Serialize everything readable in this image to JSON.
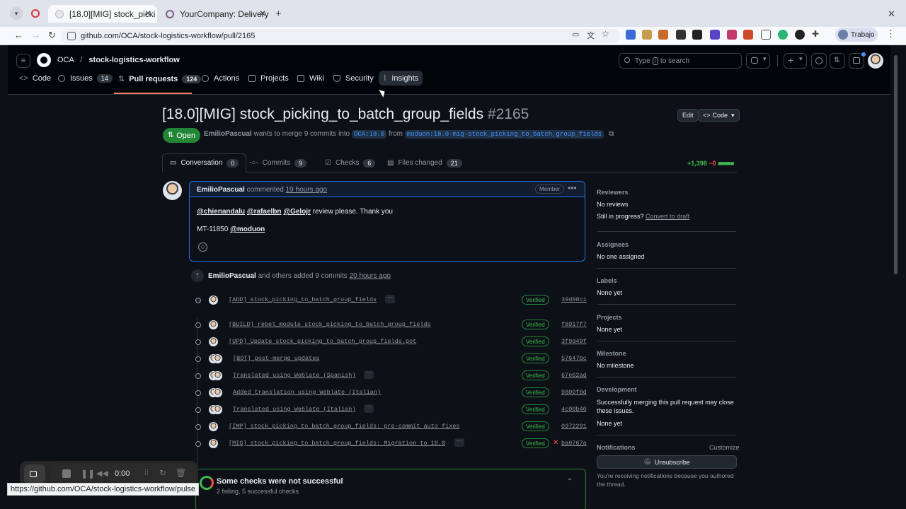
{
  "browser": {
    "tabs": [
      {
        "label": "[18.0][MIG] stock_picki",
        "active": true
      },
      {
        "label": "YourCompany: Delivery",
        "active": false
      }
    ],
    "new_tab": "+",
    "url": "github.com/OCA/stock-logistics-workflow/pull/2165",
    "profile_label": "Trabajo",
    "status_url": "https://github.com/OCA/stock-logistics-workflow/pulse"
  },
  "header": {
    "org": "OCA",
    "sep": "/",
    "repo": "stock-logistics-workflow",
    "search_prefix": "Type",
    "search_key": "/",
    "search_suffix": "to search",
    "nav": [
      {
        "label": "Code",
        "count": ""
      },
      {
        "label": "Issues",
        "count": "14"
      },
      {
        "label": "Pull requests",
        "count": "124"
      },
      {
        "label": "Actions",
        "count": ""
      },
      {
        "label": "Projects",
        "count": ""
      },
      {
        "label": "Wiki",
        "count": ""
      },
      {
        "label": "Security",
        "count": ""
      },
      {
        "label": "Insights",
        "count": ""
      }
    ]
  },
  "pr": {
    "title": "[18.0][MIG] stock_picking_to_batch_group_fields",
    "number": "#2165",
    "edit_label": "Edit",
    "code_label": "Code",
    "state": "Open",
    "author": "EmilioPascual",
    "wants_text": "wants to merge 9 commits into",
    "base": "OCA:18.0",
    "from_text": "from",
    "head": "moduon:18.0-mig-stock_picking_to_batch_group_fields",
    "tabs": [
      {
        "label": "Conversation",
        "count": "0"
      },
      {
        "label": "Commits",
        "count": "9"
      },
      {
        "label": "Checks",
        "count": "6"
      },
      {
        "label": "Files changed",
        "count": "21"
      }
    ],
    "additions": "+1,398",
    "deletions": "−0"
  },
  "comment": {
    "author": "EmilioPascual",
    "action": "commented",
    "time": "19 hours ago",
    "role": "Member",
    "mentions": [
      "@chienandalu",
      "@rafaelbn",
      "@Gelojr"
    ],
    "line1_suffix": "review please. Thank you",
    "line2_prefix": "MT-11850",
    "line2_mention": "@moduon"
  },
  "commits_event": {
    "author": "EmilioPascual",
    "text": "and others added 9 commits",
    "time": "20 hours ago"
  },
  "commits": [
    {
      "msg": "[ADD] stock_picking_to_batch_group_fields",
      "verified": "Verified",
      "sha": "39d98c1",
      "more": true,
      "fail": false
    },
    {
      "msg": "[BUILD] rebel_module stock_picking_to_batch_group_fields",
      "verified": "Verified",
      "sha": "f8917f7",
      "more": false,
      "fail": false
    },
    {
      "msg": "[UPD] Update stock_picking_to_batch_group_fields.pot",
      "verified": "Verified",
      "sha": "3f9d49f",
      "more": false,
      "fail": false
    },
    {
      "msg": "[BOT] post-merge updates",
      "verified": "Verified",
      "sha": "57647bc",
      "more": false,
      "fail": false
    },
    {
      "msg": "Translated using Weblate (Spanish)",
      "verified": "Verified",
      "sha": "67e62ad",
      "more": true,
      "fail": false
    },
    {
      "msg": "Added translation using Weblate (Italian)",
      "verified": "Verified",
      "sha": "9809f0d",
      "more": false,
      "fail": false
    },
    {
      "msg": "Translated using Weblate (Italian)",
      "verified": "Verified",
      "sha": "4c00b40",
      "more": true,
      "fail": false
    },
    {
      "msg": "[IMP] stock_picking_to_batch_group_fields: pre-commit auto fixes",
      "verified": "Verified",
      "sha": "0372291",
      "more": false,
      "fail": false
    },
    {
      "msg": "[MIG] stock_picking_to_batch_group_fields: Migration to 18.0",
      "verified": "Verified",
      "sha": "ba0767a",
      "more": true,
      "fail": true
    }
  ],
  "checks": {
    "title": "Some checks were not successful",
    "summary": "2 failing, 5 successful checks"
  },
  "sidebar": {
    "reviewers_h": "Reviewers",
    "reviewers_t": "No reviews",
    "in_progress": "Still in progress?",
    "convert": "Convert to draft",
    "assignees_h": "Assignees",
    "assignees_t": "No one assigned",
    "labels_h": "Labels",
    "labels_t": "None yet",
    "projects_h": "Projects",
    "projects_t": "None yet",
    "milestone_h": "Milestone",
    "milestone_t": "No milestone",
    "dev_h": "Development",
    "dev_t": "Successfully merging this pull request may close these issues.",
    "dev_t2": "None yet",
    "notif_h": "Notifications",
    "customize": "Customize",
    "unsubscribe": "Unsubscribe",
    "notif_t": "You're receiving notifications because you authored the thread."
  },
  "recorder": {
    "time": "0:00"
  },
  "colors": {
    "accent": "#1f6feb",
    "open": "#238636",
    "verified": "#3fb950",
    "fail": "#f85149"
  }
}
